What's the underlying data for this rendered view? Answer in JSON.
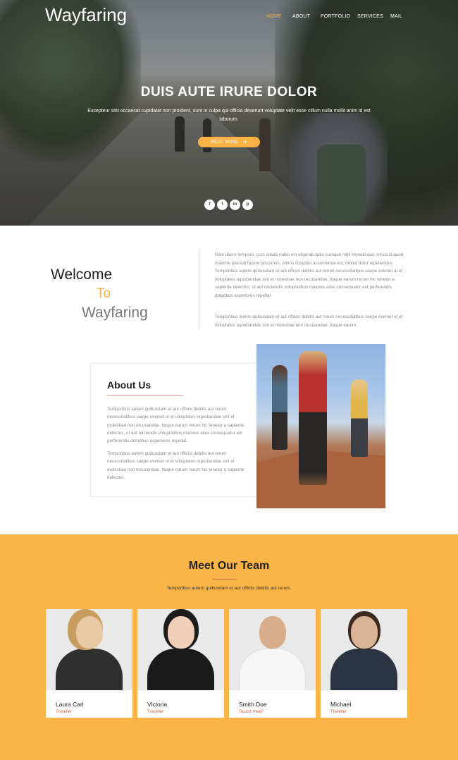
{
  "header": {
    "logo": "Wayfaring",
    "nav": [
      "HOME",
      "ABOUT",
      "PORTFOLIO",
      "SERVICES",
      "MAIL"
    ],
    "active_nav": "HOME"
  },
  "hero": {
    "title": "DUIS AUTE IRURE DOLOR",
    "text": "Excepteur sint occaecat cupidatat non proident, sunt in culpa qui officia deserunt voluptate velit esse cillum nulla mollit anim id est laborum.",
    "button_label": "READ MORE",
    "social_icons": [
      "facebook-icon",
      "twitter-icon",
      "linkedin-icon",
      "pinterest-icon"
    ],
    "social_glyphs": [
      "f",
      "t",
      "in",
      "p"
    ]
  },
  "welcome": {
    "line1": "Welcome",
    "line2": "To",
    "line3": "Wayfaring",
    "paragraph1": "Nam libero tempore, cum soluta nobis est eligendi optio cumque nihil impedit quo minus id quod maxime placeat facere possimus, omnis voluptas assumenda est, omnis dolor repellendus. Temporibus autem quibusdam et aut officiis debitis aut rerum necessitatibus saepe eveniet ut et voluptates repudiandae sint et molestiae non recusandae. Itaque earum rerum hic tenetur a sapiente delectus, ut aut reiciendis voluptatibus maiores alias consequatur aut perferendis doloribus asperiores repellat.",
    "paragraph2": "Temporibus autem quibusdam et aut officiis debitis aut rerum necessitatibus saepe eveniet ut et voluptates repudiandae sint et molestiae non recusandae. Itaque earum"
  },
  "about": {
    "title": "About Us",
    "paragraph1": "Temporibus autem quibusdam et aut officiis debitis aut rerum necessitatibus saepe eveniet ut et voluptates repudiandae sint et molestiae non recusandae. Itaque earum rerum hic tenetur a sapiente delectus, ut aut reiciendis voluptatibus maiores alias consequatur aut perferendis doloribus asperiores repellat.",
    "paragraph2": "Temporibus autem quibusdam et aut officiis debitis aut rerum necessitatibus saepe eveniet ut et voluptates repudiandae sint et molestiae non recusandae. Itaque earum rerum hic tenetur a sapiente delectus."
  },
  "team": {
    "title": "Meet Our Team",
    "subtitle": "Temporibus autem quibusdam et aut officiis debitis aut rerum.",
    "members": [
      {
        "name": "Laura Carl",
        "role": "Traveller"
      },
      {
        "name": "Victoria",
        "role": "Traveller"
      },
      {
        "name": "Smith Doe",
        "role": "Tourist Head"
      },
      {
        "name": "Michael",
        "role": "Traveller"
      }
    ]
  },
  "colors": {
    "accent": "#f9b243",
    "team_background": "#fbb447",
    "role_text": "#e0633f"
  }
}
